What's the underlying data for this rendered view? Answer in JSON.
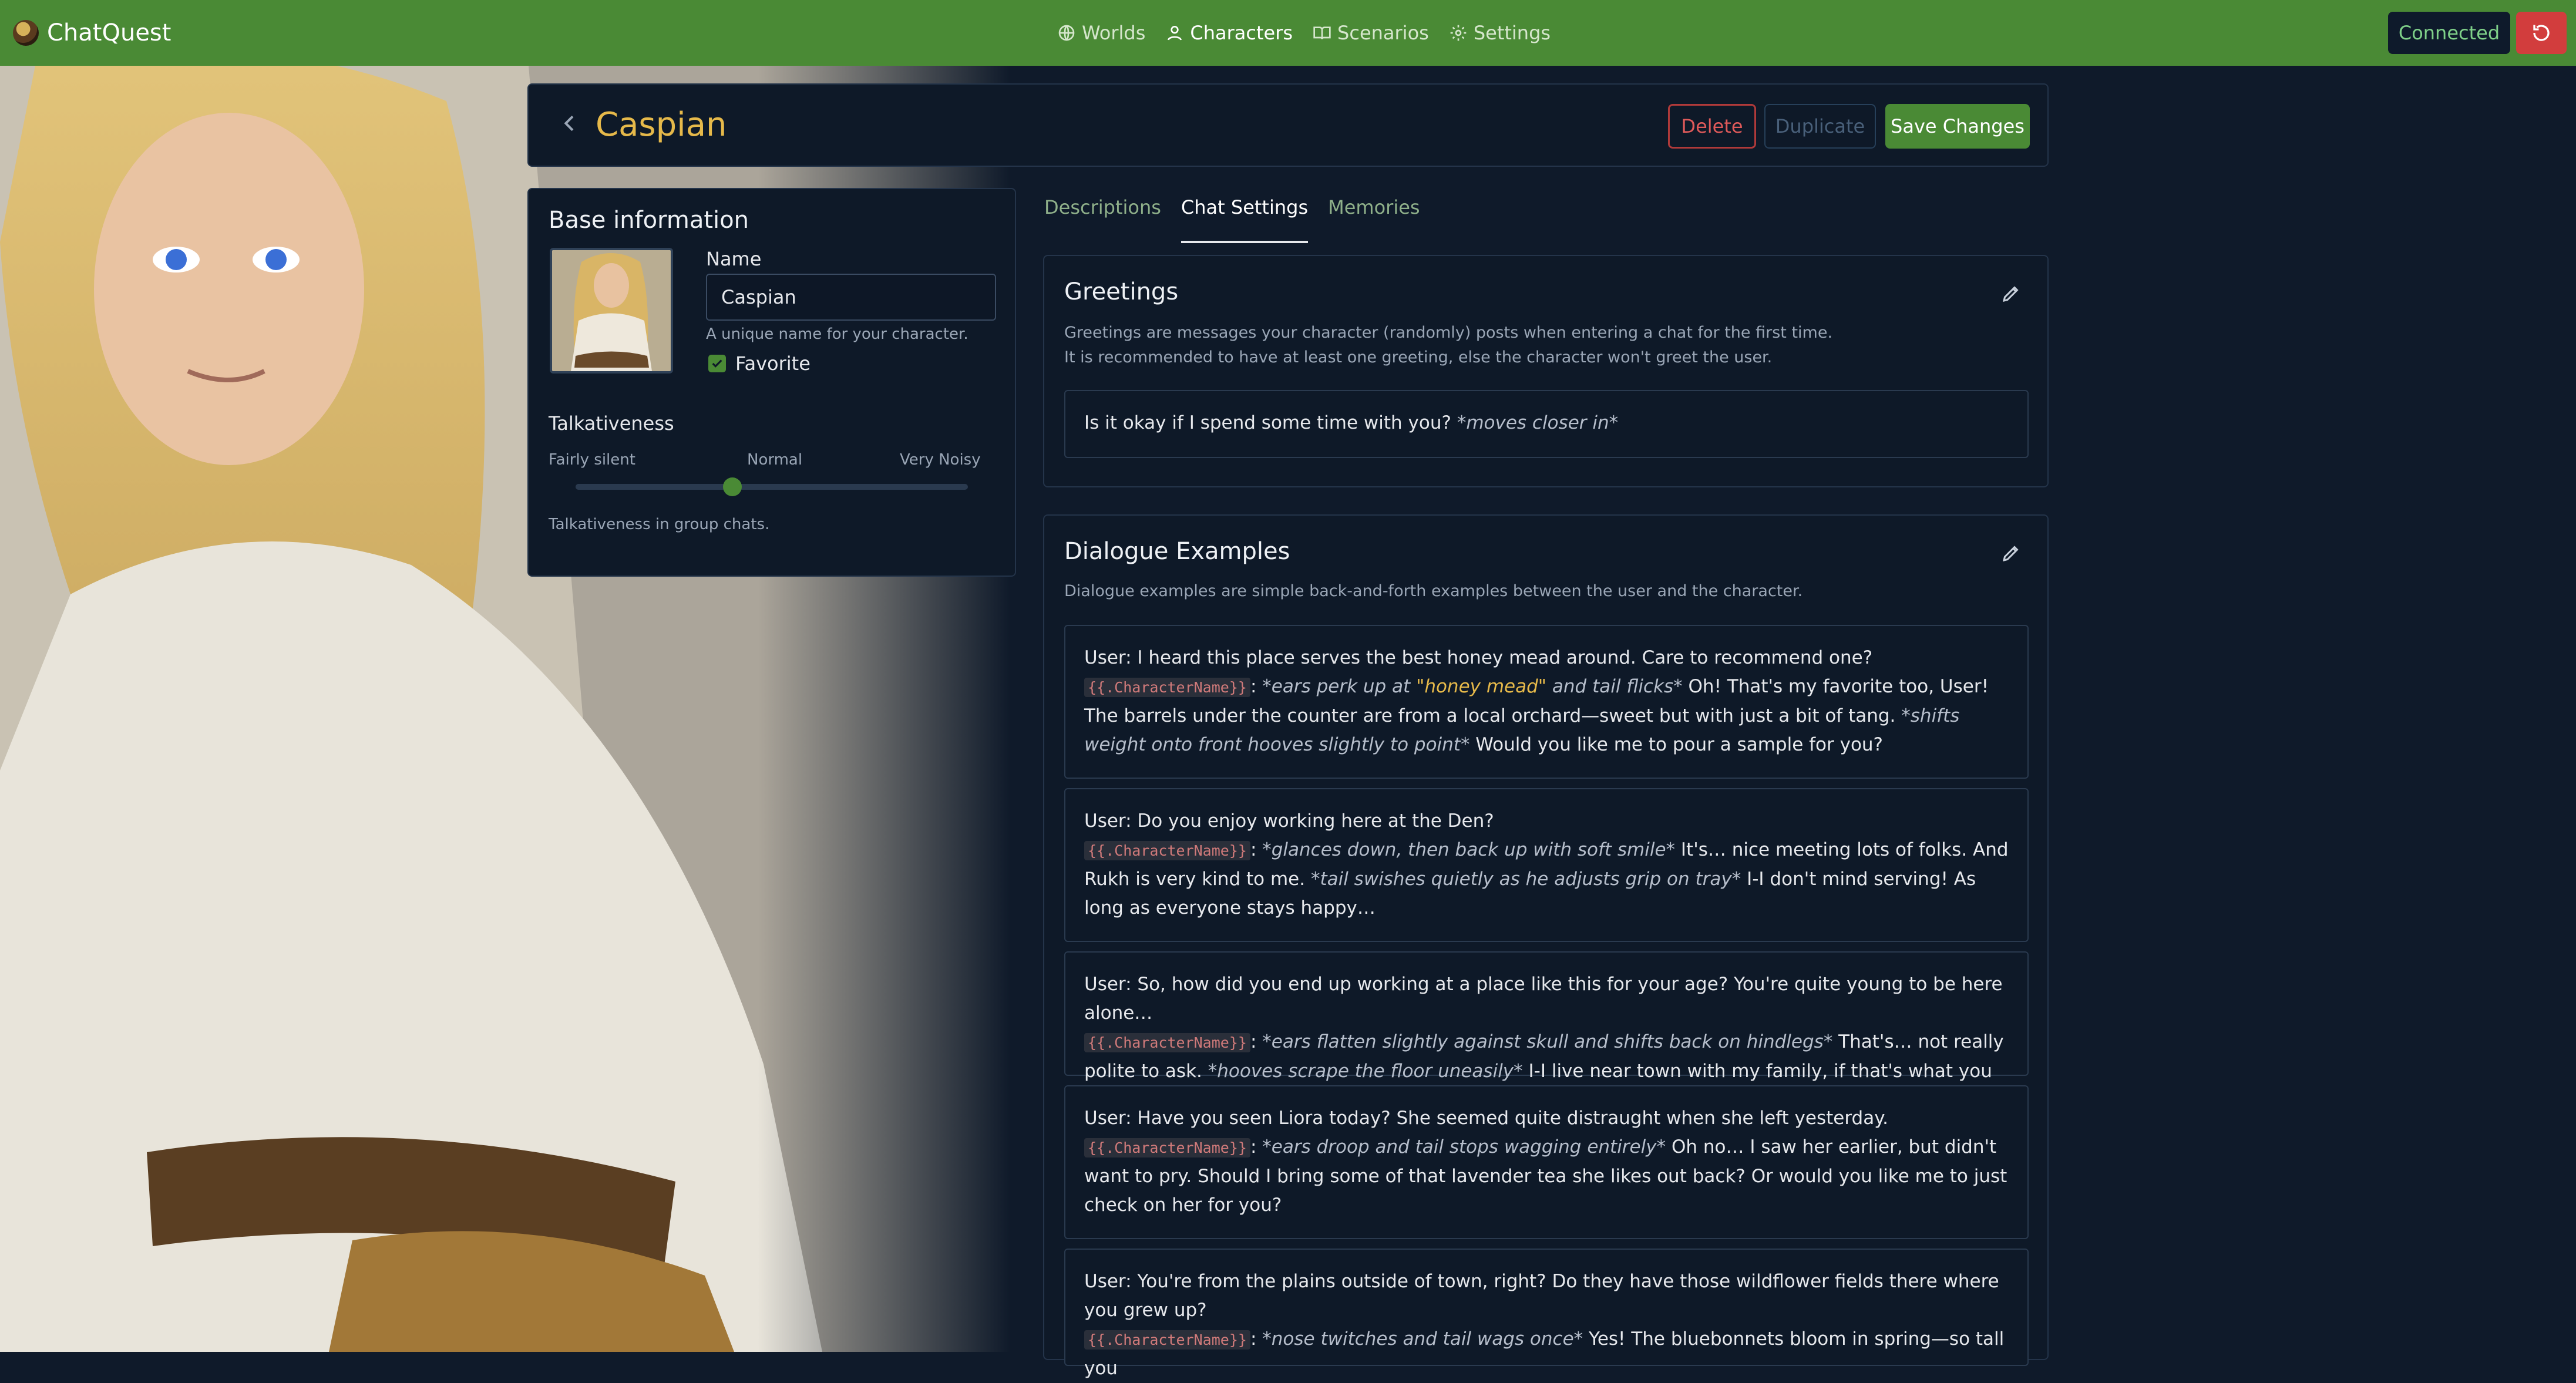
{
  "app": {
    "brand": "ChatQuest",
    "nav": [
      {
        "label": "Worlds",
        "icon": "globe-icon"
      },
      {
        "label": "Characters",
        "icon": "user-icon"
      },
      {
        "label": "Scenarios",
        "icon": "book-icon"
      },
      {
        "label": "Settings",
        "icon": "gear-icon"
      }
    ],
    "active_nav": "Characters",
    "status": "Connected"
  },
  "header": {
    "title": "Caspian",
    "delete_label": "Delete",
    "duplicate_label": "Duplicate",
    "save_label": "Save Changes"
  },
  "base_info": {
    "title": "Base information",
    "name_label": "Name",
    "name_value": "Caspian",
    "name_help": "A unique name for your character.",
    "favorite_label": "Favorite",
    "favorite_checked": true,
    "talkativeness_title": "Talkativeness",
    "scale_low": "Fairly silent",
    "scale_mid": "Normal",
    "scale_high": "Very Noisy",
    "talkativeness_value": 0.4,
    "talkativeness_help": "Talkativeness in group chats."
  },
  "tabs": [
    "Descriptions",
    "Chat Settings",
    "Memories"
  ],
  "active_tab": "Chat Settings",
  "greetings": {
    "title": "Greetings",
    "desc_line1": "Greetings are messages your character (randomly) posts when entering a chat for the first time.",
    "desc_line2": "It is recommended to have at least one greeting, else the character won't greet the user.",
    "items": [
      {
        "text": "Is it okay if I spend some time with you?",
        "action": "*moves closer in*"
      }
    ]
  },
  "dialogue": {
    "title": "Dialogue Examples",
    "desc": "Dialogue examples are simple back-and-forth examples between the user and the character.",
    "char_tag": "{{.CharacterName}}",
    "examples": [
      {
        "user": "User: I heard this place serves the best honey mead around. Care to recommend one?",
        "a1": "*ears perk up at ",
        "a1_hl": "\"honey mead\"",
        "a1_end": " and tail flicks*",
        "t1": " Oh! That's my favorite too, User! The barrels under the counter are from a local orchard—sweet but with just a bit of tang. ",
        "a2": "*shifts weight onto front hooves slightly to point*",
        "t2": " Would you like me to pour a sample for you?"
      },
      {
        "user": "User: Do you enjoy working here at the Den?",
        "a1": "*glances down, then back up with soft smile*",
        "t1": " It's… nice meeting lots of folks. And Rukh is very kind to me. ",
        "a2": "*tail swishes quietly as he adjusts grip on tray*",
        "t2": " I-I don't mind serving! As long as everyone stays happy…"
      },
      {
        "user": "User: So, how did you end up working at a place like this for your age? You're quite young to be here alone…",
        "a1": "*ears flatten slightly against skull and shifts back on hindlegs*",
        "t1": " That's… not really polite to ask. ",
        "a2": "*hooves scrape the floor uneasily*",
        "t2": " I-I live near town with my family, if that's what you were wondering!"
      },
      {
        "user": "User: Have you seen Liora today? She seemed quite distraught when she left yesterday.",
        "a1": "*ears droop and tail stops wagging entirely*",
        "t1": " Oh no… I saw her earlier, but didn't want to pry. Should I bring some of that lavender tea she likes out back? Or would you like me to just check on her for you?"
      },
      {
        "user": "User: You're from the plains outside of town, right? Do they have those wildflower fields there where you grew up?",
        "a1": "*nose twitches and tail wags once*",
        "t1": " Yes! The bluebonnets bloom in spring—so tall you"
      }
    ]
  },
  "colors": {
    "topbar": "#4a8a35",
    "title_gold": "#e6b94a",
    "danger": "#d23d3d",
    "background": "#0f1a2a"
  }
}
